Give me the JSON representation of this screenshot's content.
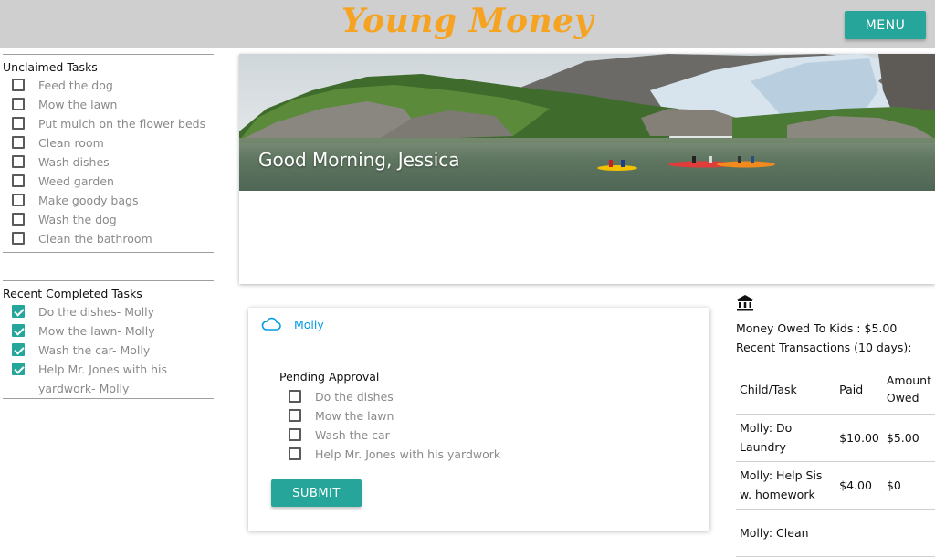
{
  "header": {
    "brand": "Young Money",
    "menu_label": "MENU"
  },
  "unclaimed": {
    "title": "Unclaimed Tasks",
    "tasks": [
      "Feed the dog",
      "Mow the lawn",
      "Put mulch on the flower beds",
      "Clean room",
      "Wash dishes",
      "Weed garden",
      "Make goody bags",
      "Wash the dog",
      "Clean the bathroom"
    ]
  },
  "completed": {
    "title": "Recent Completed Tasks",
    "tasks": [
      "Do the dishes- Molly",
      "Mow the lawn- Molly",
      "Wash the car- Molly",
      "Help Mr. Jones with his yardwork- Molly"
    ]
  },
  "hero": {
    "greeting": "Good Morning, Jessica"
  },
  "child_card": {
    "name": "Molly",
    "pending_title": "Pending Approval",
    "tasks": [
      "Do the dishes",
      "Mow the lawn",
      "Wash the car",
      "Help Mr. Jones with his yardwork"
    ],
    "submit_label": "SUBMIT"
  },
  "summary": {
    "owed": "Money Owed To Kids : $5.00",
    "recent": "Recent Transactions (10 days):",
    "headers": [
      "Child/Task",
      "Paid",
      "Amount Owed"
    ],
    "rows": [
      [
        "Molly: Do Laundry",
        "$10.00",
        "$5.00"
      ],
      [
        "Molly: Help Sis w. homework",
        "$4.00",
        "$0"
      ],
      [
        "Molly: Clean",
        "",
        ""
      ]
    ]
  },
  "colors": {
    "accent": "#26a69a",
    "brand": "#f5a320",
    "link": "#039be5",
    "header_bg": "#cfcfcf"
  },
  "icons": {
    "child": "cloud-icon",
    "bank": "bank-icon"
  }
}
